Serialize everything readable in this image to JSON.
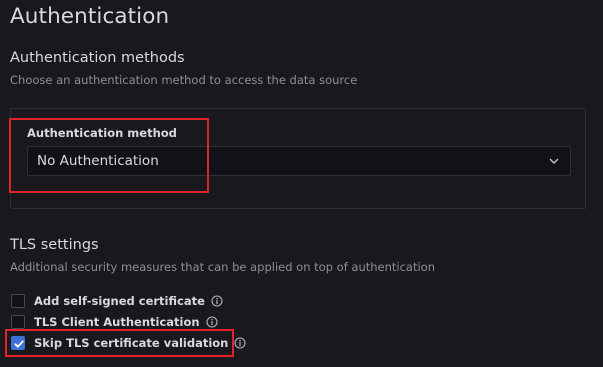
{
  "page": {
    "title": "Authentication"
  },
  "auth_methods": {
    "title": "Authentication methods",
    "description": "Choose an authentication method to access the data source",
    "field_label": "Authentication method",
    "selected_value": "No Authentication"
  },
  "tls": {
    "title": "TLS settings",
    "description": "Additional security measures that can be applied on top of authentication",
    "options": [
      {
        "label": "Add self-signed certificate",
        "checked": false
      },
      {
        "label": "TLS Client Authentication",
        "checked": false
      },
      {
        "label": "Skip TLS certificate validation",
        "checked": true
      }
    ]
  },
  "colors": {
    "background": "#18181d",
    "accent": "#3d71d9",
    "highlight": "#e0222a"
  }
}
